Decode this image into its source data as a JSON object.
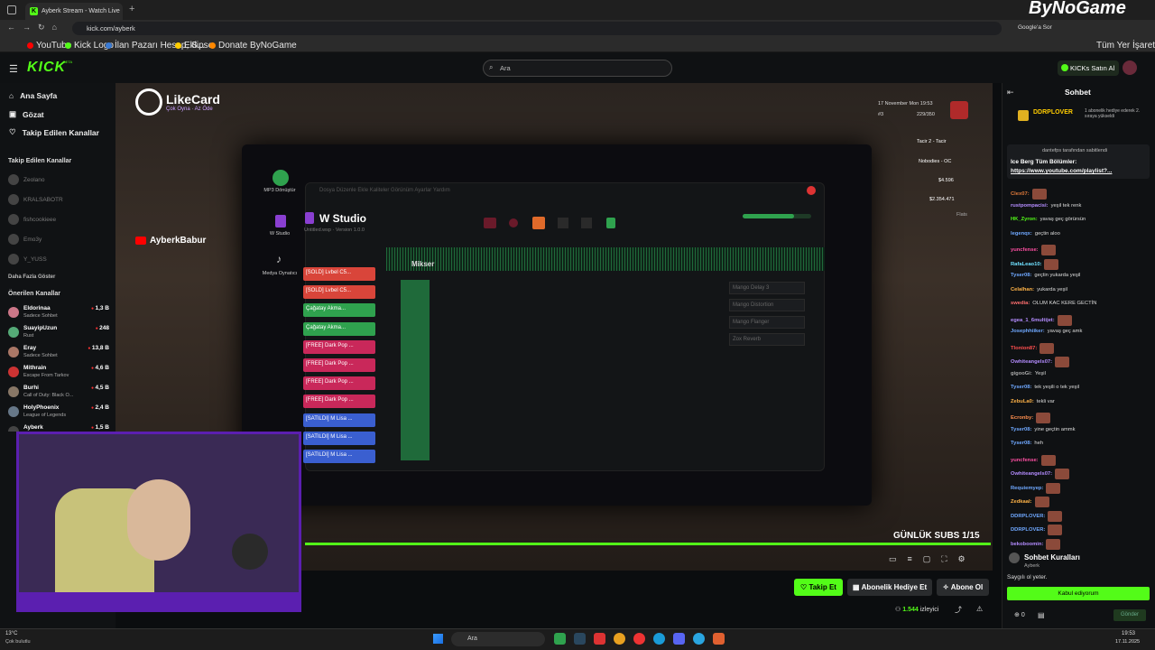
{
  "browser": {
    "tab_title": "Ayberk Stream - Watch Live",
    "url": "kick.com/ayberk",
    "bookmarks": [
      "YouTube",
      "Kick Logo",
      "İlan Pazarı Hesap, S...",
      "Eklipse",
      "Donate ByNoGame"
    ],
    "google_label": "Google'a Sor",
    "all_bookmarks": "Tüm Yer İşaretleri",
    "watermark": "ByNoGame"
  },
  "header": {
    "logo": "KICK",
    "logo_badge": "BETA",
    "search_placeholder": "Ara",
    "kicks_button": "KICKs Satın Al"
  },
  "sidebar": {
    "nav": [
      "Ana Sayfa",
      "Gözat",
      "Takip Edilen Kanallar"
    ],
    "following_title": "Takip Edilen Kanallar",
    "following": [
      "Zeolano",
      "KRALSABOTR",
      "fishcookieee",
      "Emo3y",
      "Y_YUSS"
    ],
    "show_more": "Daha Fazla Göster",
    "recommended_title": "Önerilen Kanallar",
    "recommended": [
      {
        "name": "Eldorinaa",
        "category": "Sadece Sohbet",
        "viewers": "1,3 B"
      },
      {
        "name": "SuayipUzun",
        "category": "Rust",
        "viewers": "248"
      },
      {
        "name": "Eray",
        "category": "Sadece Sohbet",
        "viewers": "13,8 B"
      },
      {
        "name": "Mithrain",
        "category": "Escape From Tarkov",
        "viewers": "4,6 B"
      },
      {
        "name": "Burhi",
        "category": "Call of Duty: Black O...",
        "viewers": "4,5 B"
      },
      {
        "name": "HolyPhoenix",
        "category": "League of Legends",
        "viewers": "2,4 B"
      },
      {
        "name": "Ayberk",
        "category": "",
        "viewers": "1,5 B"
      }
    ]
  },
  "video": {
    "sponsor": "LikeCard",
    "sponsor_tagline": "Çok Oyna · Az Öde",
    "channel_tag": "AyberkBabur",
    "studio_title": "W Studio",
    "studio_subtitle": "Untitled.wsp · Version 1.0.0",
    "studio_menu": "Dosya  Düzenle  Ekle  Kaliteler  Görünüm  Ayarlar  Yardım",
    "sidebar_apps": [
      "MP3 Dönüştür",
      "W Studio",
      "Medya Oynatıcı"
    ],
    "mixer_label": "Mikser",
    "tracks": [
      {
        "label": "[SOLD] Lvbel C5...",
        "color": "#d9453a"
      },
      {
        "label": "[SOLD] Lvbel C5...",
        "color": "#d9453a"
      },
      {
        "label": "Çağatay Akma...",
        "color": "#2fa24e"
      },
      {
        "label": "Çağatay Akma...",
        "color": "#2fa24e"
      },
      {
        "label": "[FREE] Dark Pop ...",
        "color": "#c9285a"
      },
      {
        "label": "[FREE] Dark Pop ...",
        "color": "#c9285a"
      },
      {
        "label": "[FREE] Dark Pop ...",
        "color": "#c9285a"
      },
      {
        "label": "[FREE] Dark Pop ...",
        "color": "#c9285a"
      },
      {
        "label": "[SATILDI] M Lisa ...",
        "color": "#3a5fd0"
      },
      {
        "label": "[SATILDI] M Lisa ...",
        "color": "#3a5fd0"
      },
      {
        "label": "[SATILDI] M Lisa ...",
        "color": "#3a5fd0"
      }
    ],
    "effects": [
      "Mango Delay 3",
      "Mango Distortion",
      "Mango Flanger",
      "Zox Reverb"
    ],
    "hud_date": "17 November Mon 19:53",
    "hud_rank": "#3",
    "hud_hp": "229/350",
    "hud_job": "Tacir 2 - Tacir",
    "hud_gang": "Nobodies - OC",
    "hud_cash": "$4.596",
    "hud_bank": "$2.354.471",
    "hud_phone": "Flats",
    "subs_goal": "GÜNLÜK SUBS 1/15",
    "progress": 1.0
  },
  "actions": {
    "follow": "Takip Et",
    "gift": "Abonelik Hediye Et",
    "subscribe": "Abone Ol",
    "viewers": "1.544",
    "viewers_label": "izleyici"
  },
  "chat": {
    "title": "Sohbet",
    "top_gifter": "DDRPLOVER",
    "top_gift_text": "1 abonelik hediye ederek 2. sıraya yükseldi",
    "pinned_by": "dantefps tarafından sabitlendi",
    "pinned_text": "Ice Berg Tüm Bölümler:",
    "pinned_link": "https://www.youtube.com/playlist?...",
    "messages": [
      {
        "user": "Clex07:",
        "text": "",
        "color": "#e07a3a",
        "emote": true
      },
      {
        "user": "rustpompacisi:",
        "text": "yeşil tek renk",
        "color": "#b48cff",
        "emote": false
      },
      {
        "user": "HK_Zyron:",
        "text": "yavaş geç görürsün",
        "color": "#53fc18",
        "emote": false
      },
      {
        "user": "legenqx:",
        "text": "geçtin aloo",
        "color": "#6fa8ff",
        "emote": false
      },
      {
        "user": "yuncfense:",
        "text": "",
        "color": "#ff4fa3",
        "emote": true
      },
      {
        "user": "RafaLeao10:",
        "text": "",
        "color": "#6fe0ff",
        "emote": true
      },
      {
        "user": "Tyser08:",
        "text": "geçtin yukarda yeşil",
        "color": "#6fa8ff",
        "emote": false
      },
      {
        "user": "Celalhan:",
        "text": "yukarda yeşil",
        "color": "#ffb347",
        "emote": false
      },
      {
        "user": "swedia:",
        "text": "OLUM KAC KERE GECTİN",
        "color": "#ff6f6f",
        "emote": false
      },
      {
        "user": "egea_1_6multijet:",
        "text": "",
        "color": "#b48cff",
        "emote": true
      },
      {
        "user": "Josephhiiker:",
        "text": "yavaş geç amk",
        "color": "#6fa8ff",
        "emote": false
      },
      {
        "user": "Tlonion87:",
        "text": "",
        "color": "#ff4f4f",
        "emote": true
      },
      {
        "user": "Owhiteangels07:",
        "text": "",
        "color": "#b48cff",
        "emote": true
      },
      {
        "user": "gigooGi:",
        "text": "Yeşil",
        "color": "#aaaaaa",
        "emote": false
      },
      {
        "user": "Tyser08:",
        "text": "tek yeşili o tek yeşil",
        "color": "#6fa8ff",
        "emote": false
      },
      {
        "user": "ZebuLa0:",
        "text": "tekli var",
        "color": "#ffb347",
        "emote": false
      },
      {
        "user": "Ecronby:",
        "text": "",
        "color": "#ff8f4f",
        "emote": true
      },
      {
        "user": "Tyser08:",
        "text": "yine geçtin ammk",
        "color": "#6fa8ff",
        "emote": false
      },
      {
        "user": "Tyser08:",
        "text": "heh",
        "color": "#6fa8ff",
        "emote": false
      },
      {
        "user": "yuncfense:",
        "text": "",
        "color": "#ff4fa3",
        "emote": true
      },
      {
        "user": "Owhiteangels07:",
        "text": "",
        "color": "#b48cff",
        "emote": true
      },
      {
        "user": "Requiemyep:",
        "text": "",
        "color": "#6fa8ff",
        "emote": true
      },
      {
        "user": "Zedkaal:",
        "text": "",
        "color": "#ffb347",
        "emote": true
      },
      {
        "user": "DDRPLOVER:",
        "text": "",
        "color": "#6fa8ff",
        "emote": true
      },
      {
        "user": "DDRPLOVER:",
        "text": "",
        "color": "#6fa8ff",
        "emote": true
      },
      {
        "user": "bekoboomin:",
        "text": "",
        "color": "#b48cff",
        "emote": true
      }
    ],
    "rules_title": "Sohbet Kuralları",
    "rules_user": "Ayberk",
    "rules_text": "Saygılı ol yeter.",
    "accept": "Kabul ediyorum",
    "send": "Gönder",
    "kicks_count": "0"
  },
  "taskbar": {
    "weather_temp": "13°C",
    "weather_desc": "Çok bulutlu",
    "search": "Ara",
    "time": "19:53",
    "date": "17.11.2025"
  }
}
